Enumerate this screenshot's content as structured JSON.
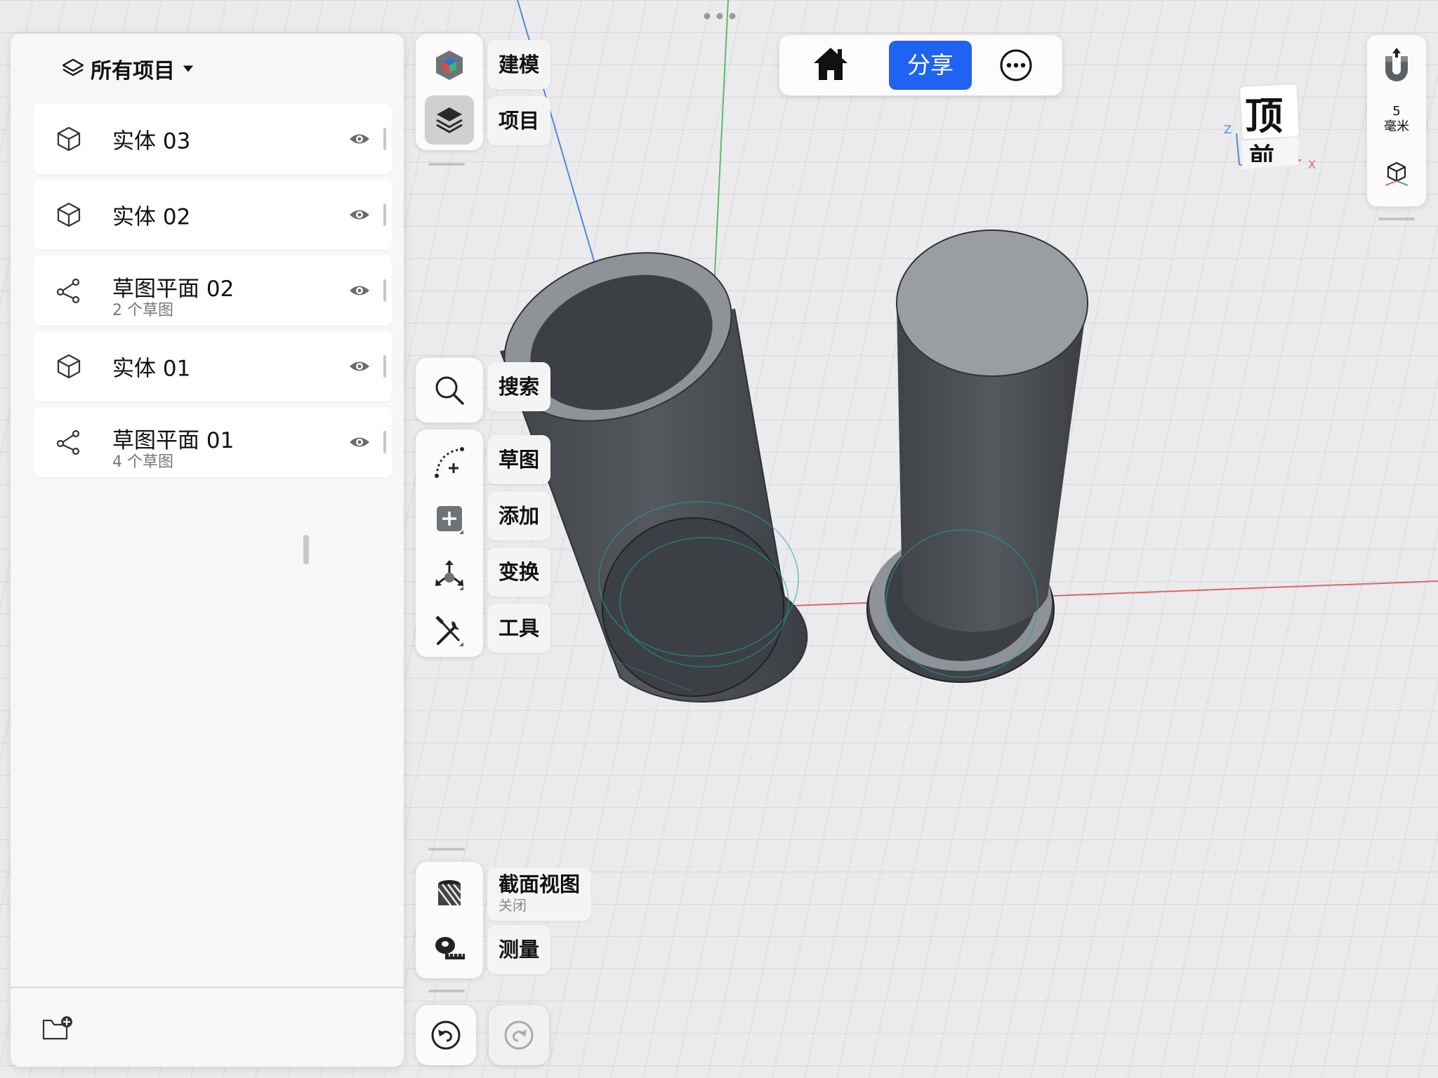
{
  "colors": {
    "accent": "#1f63f2",
    "axis_x": "#e06565",
    "axis_y": "#5dbb6a",
    "axis_z": "#4a8ae8",
    "body": "#4a4d52",
    "cap": "#9a9ea2"
  },
  "panel": {
    "title": "所有项目",
    "items": [
      {
        "icon": "cube-icon",
        "name": "实体  03",
        "sub": ""
      },
      {
        "icon": "cube-icon",
        "name": "实体  02",
        "sub": ""
      },
      {
        "icon": "sketch-node-icon",
        "name": "草图平面 02",
        "sub": "2 个草图"
      },
      {
        "icon": "cube-icon",
        "name": "实体  01",
        "sub": ""
      },
      {
        "icon": "sketch-node-icon",
        "name": "草图平面 01",
        "sub": "4 个草图"
      }
    ]
  },
  "toolbar": {
    "modeling": "建模",
    "items": "项目",
    "search": "搜索",
    "sketch": "草图",
    "add": "添加",
    "transform": "变换",
    "tools": "工具",
    "section_view": "截面视图",
    "section_state": "关闭",
    "measure": "测量"
  },
  "topbar": {
    "share": "分享"
  },
  "viewcube": {
    "top": "顶",
    "front": "前",
    "axis_z": "Z",
    "axis_x": "X"
  },
  "snap": {
    "value": "5",
    "unit": "毫米"
  }
}
